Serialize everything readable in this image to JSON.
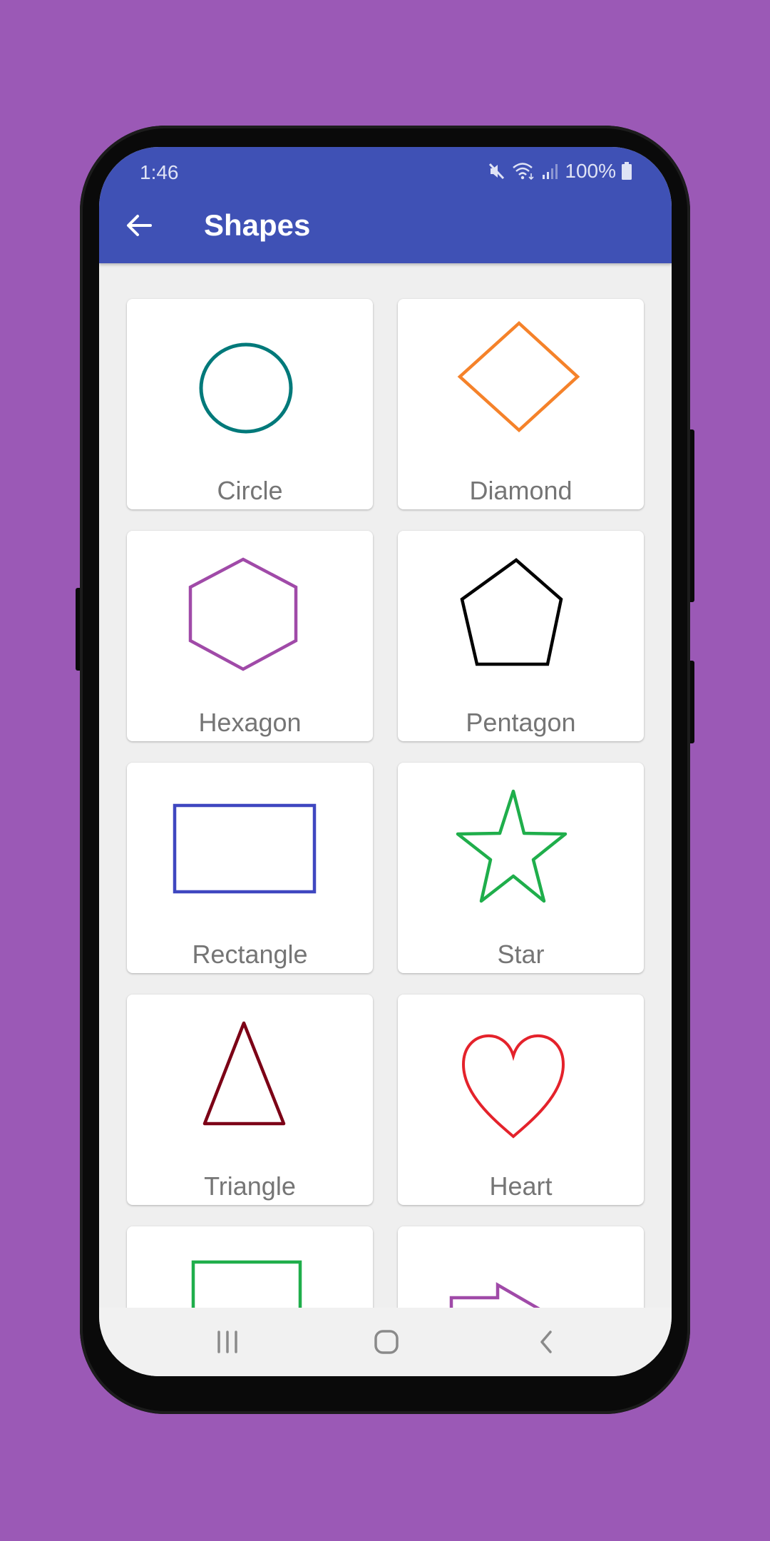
{
  "status_bar": {
    "time": "1:46",
    "icons": [
      "mute-icon",
      "wifi-icon",
      "signal-icon"
    ],
    "battery": "100%"
  },
  "app_bar": {
    "back_icon": "arrow-left-icon",
    "title": "Shapes",
    "color": "#3f51b5"
  },
  "shapes": [
    {
      "label": "Circle",
      "type": "circle",
      "color": "#00797a"
    },
    {
      "label": "Diamond",
      "type": "diamond",
      "color": "#f5822a"
    },
    {
      "label": "Hexagon",
      "type": "hexagon",
      "color": "#a04aa8"
    },
    {
      "label": "Pentagon",
      "type": "pentagon",
      "color": "#000000"
    },
    {
      "label": "Rectangle",
      "type": "rectangle",
      "color": "#3f47c0"
    },
    {
      "label": "Star",
      "type": "star",
      "color": "#1fae4b"
    },
    {
      "label": "Triangle",
      "type": "triangle",
      "color": "#7c0016"
    },
    {
      "label": "Heart",
      "type": "heart",
      "color": "#e4222b"
    },
    {
      "label": "",
      "type": "square",
      "color": "#1fae4b"
    },
    {
      "label": "",
      "type": "arrow",
      "color": "#a04aa8"
    }
  ],
  "nav_bar": {
    "recents_icon": "recents-icon",
    "home_icon": "home-icon",
    "back_icon": "back-chevron-icon"
  }
}
